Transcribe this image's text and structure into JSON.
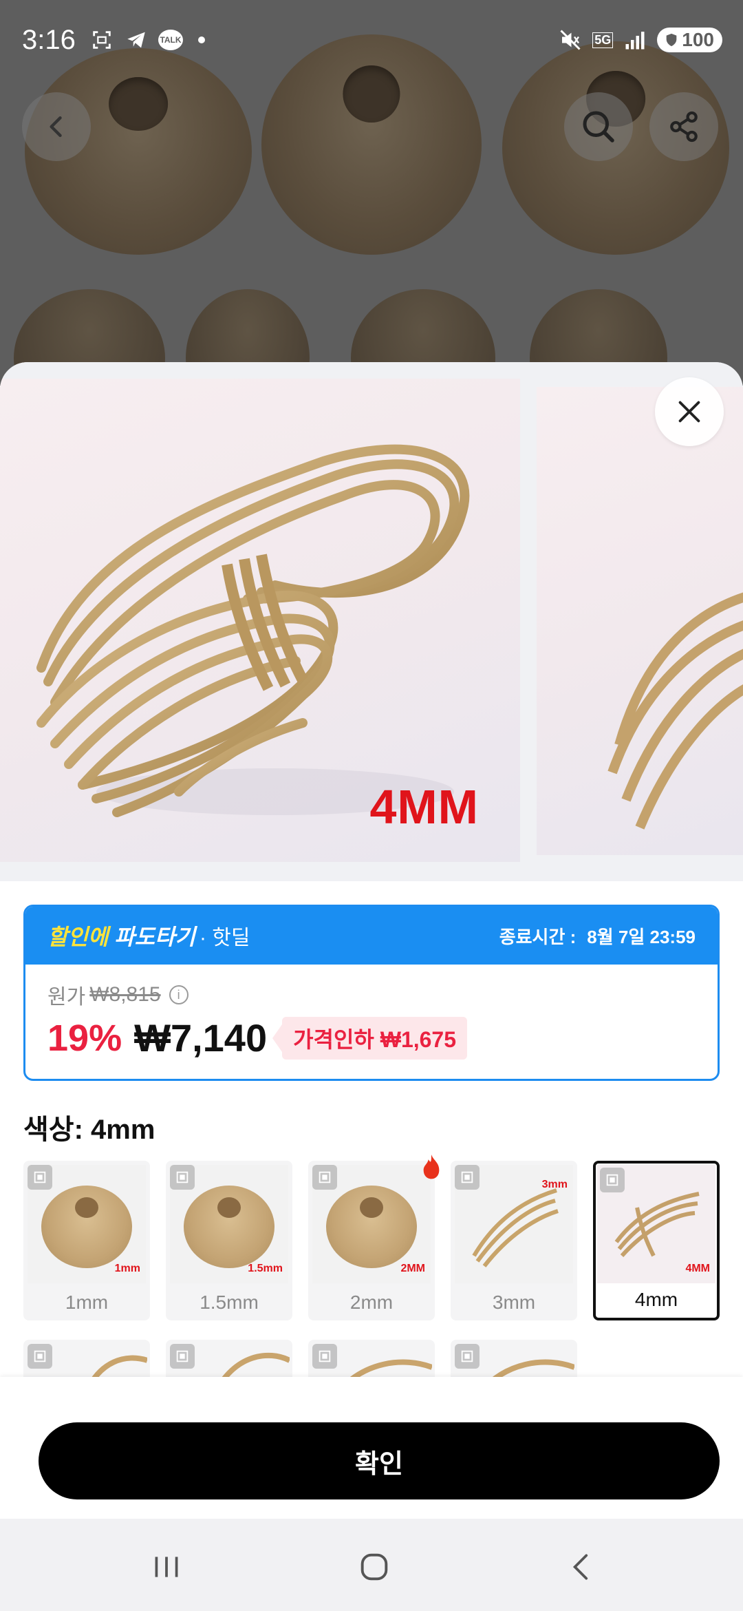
{
  "status_bar": {
    "time": "3:16",
    "talk_label": "TALK",
    "network": "5G",
    "battery": "100"
  },
  "background": {
    "back_icon": "chevron-left-icon",
    "search_icon": "search-icon",
    "share_icon": "share-icon"
  },
  "gallery": {
    "main_tag": "4MM",
    "close_icon": "close-icon"
  },
  "deal": {
    "brand_part1": "할인에",
    "brand_part2": "파도타기",
    "brand_sub": "· 핫딜",
    "end_label": "종료시간 :",
    "end_time": "8월 7일 23:59",
    "original_label": "원가",
    "original_price": "₩8,815",
    "discount": "19%",
    "price": "₩7,140",
    "price_cut": "가격인하 ₩1,675"
  },
  "color_option": {
    "label": "색상: 4mm",
    "options": [
      {
        "label": "1mm",
        "tag": "1mm"
      },
      {
        "label": "1.5mm",
        "tag": "1.5mm"
      },
      {
        "label": "2mm",
        "tag": "2MM"
      },
      {
        "label": "3mm",
        "tag": "3mm"
      },
      {
        "label": "4mm",
        "tag": "4MM"
      }
    ]
  },
  "confirm": {
    "label": "확인"
  },
  "colors": {
    "deal_blue": "#1a8ef2",
    "discount_red": "#ea2140",
    "brand_yellow": "#ffe43a"
  }
}
